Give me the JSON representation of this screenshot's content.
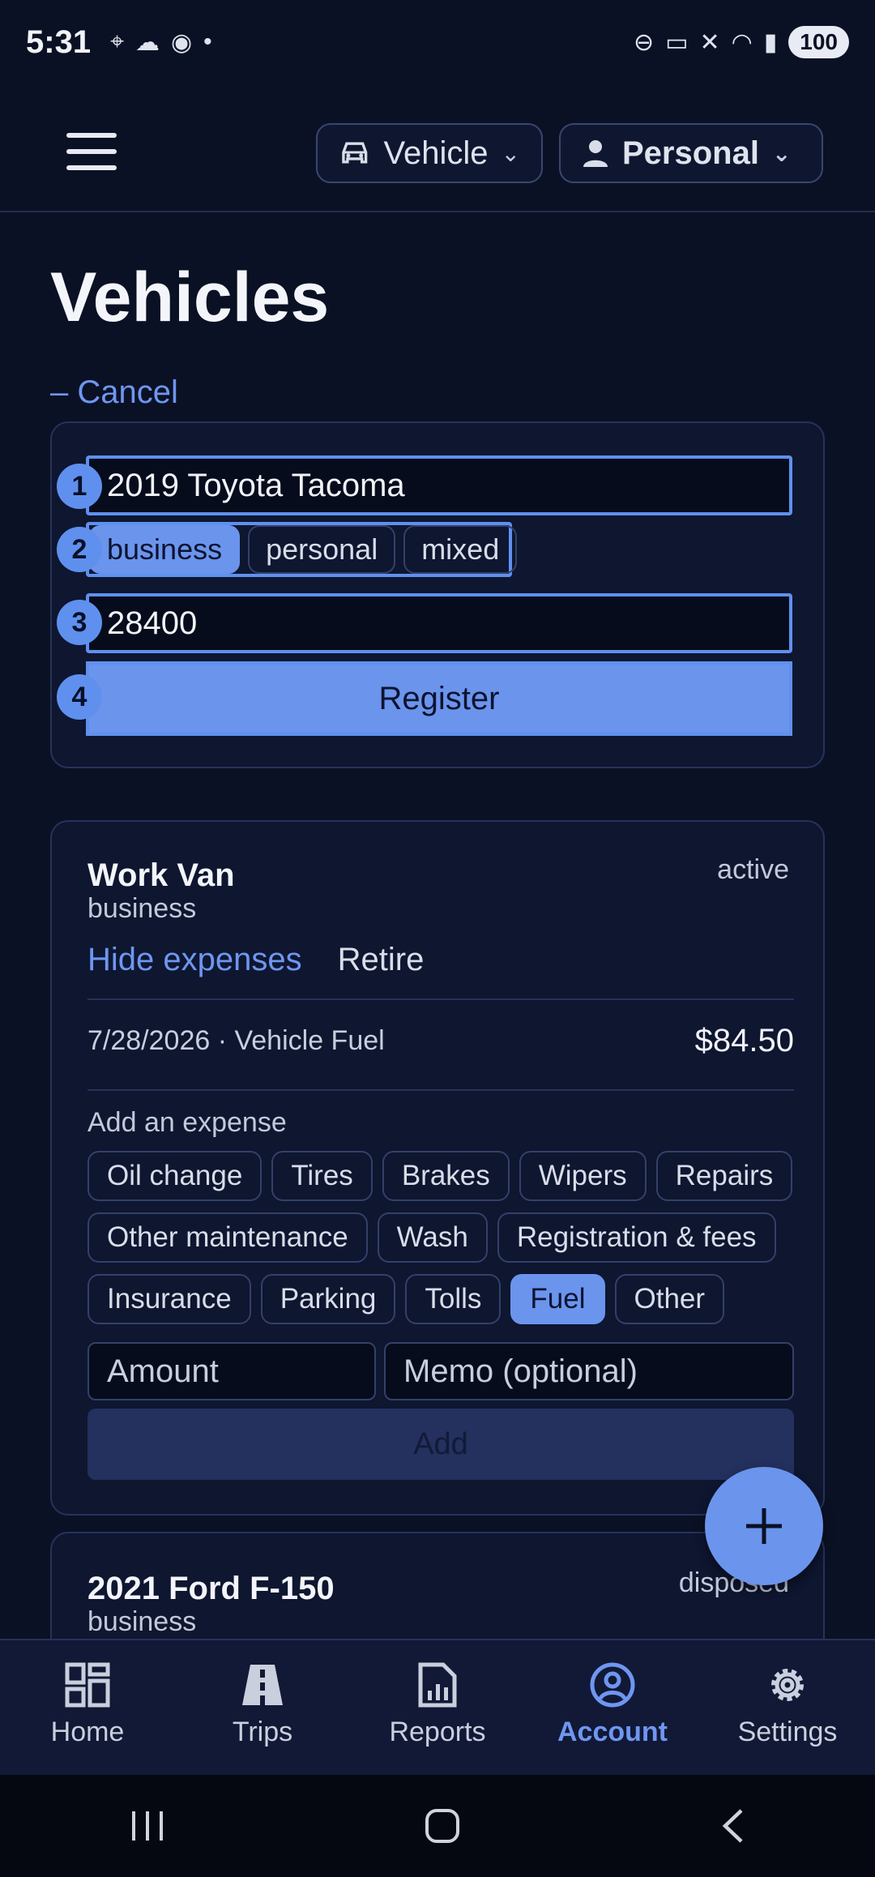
{
  "status_bar": {
    "time": "5:31",
    "battery": "100"
  },
  "header": {
    "mode_label": "Vehicle",
    "profile_label": "Personal"
  },
  "page": {
    "title": "Vehicles",
    "cancel_label": "– Cancel"
  },
  "register_form": {
    "name_value": "2019 Toyota Tacoma",
    "usage_options": [
      "business",
      "personal",
      "mixed"
    ],
    "usage_selected": "business",
    "odometer_value": "28400",
    "register_label": "Register",
    "badges": [
      "1",
      "2",
      "3",
      "4"
    ]
  },
  "vehicles": [
    {
      "name": "Work Van",
      "type": "business",
      "status": "active",
      "hide_expenses_label": "Hide expenses",
      "retire_label": "Retire",
      "expense": {
        "desc": "7/28/2026 · Vehicle Fuel",
        "amount": "$84.50"
      },
      "add_expense_title": "Add an expense",
      "categories": [
        "Oil change",
        "Tires",
        "Brakes",
        "Wipers",
        "Repairs",
        "Other maintenance",
        "Wash",
        "Registration & fees",
        "Insurance",
        "Parking",
        "Tolls",
        "Fuel",
        "Other"
      ],
      "category_selected": "Fuel",
      "amount_placeholder": "Amount",
      "memo_placeholder": "Memo (optional)",
      "add_label": "Add"
    },
    {
      "name": "2021 Ford F-150",
      "type": "business",
      "status": "disposed"
    }
  ],
  "bottom_nav": [
    {
      "label": "Home",
      "icon": "home-grid-icon"
    },
    {
      "label": "Trips",
      "icon": "road-icon"
    },
    {
      "label": "Reports",
      "icon": "report-icon"
    },
    {
      "label": "Account",
      "icon": "account-icon"
    },
    {
      "label": "Settings",
      "icon": "gear-icon"
    }
  ],
  "colors": {
    "accent": "#6b94ed",
    "background": "#0b1124",
    "card": "#0e1630"
  }
}
